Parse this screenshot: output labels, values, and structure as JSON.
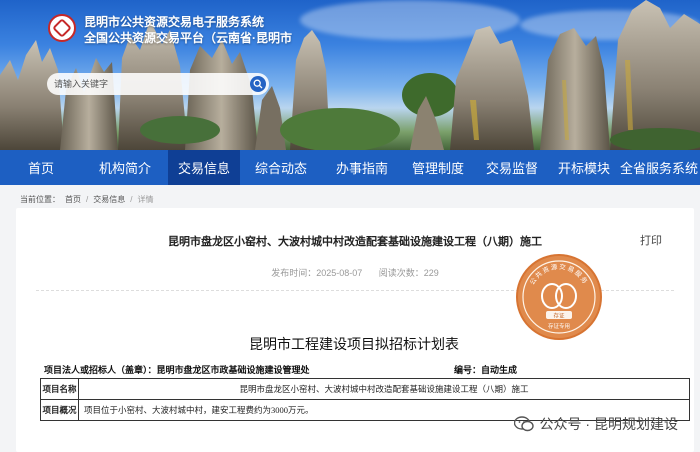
{
  "header": {
    "title_line1": "昆明市公共资源交易电子服务系统",
    "title_line2": "全国公共资源交易平台（云南省·昆明市",
    "search_placeholder": "请输入关键字"
  },
  "nav": {
    "items": [
      {
        "label": "首页",
        "active": false
      },
      {
        "label": "机构简介",
        "active": false
      },
      {
        "label": "交易信息",
        "active": true
      },
      {
        "label": "综合动态",
        "active": false
      },
      {
        "label": "办事指南",
        "active": false
      },
      {
        "label": "管理制度",
        "active": false
      },
      {
        "label": "交易监督",
        "active": false
      },
      {
        "label": "开标模块",
        "active": false
      },
      {
        "label": "全省服务系统",
        "active": false
      }
    ]
  },
  "breadcrumb": {
    "prefix": "当前位置：",
    "items": [
      "首页",
      "交易信息",
      "详情"
    ]
  },
  "article": {
    "title": "昆明市盘龙区小窑村、大波村城中村改造配套基础设施建设工程（八期）施工",
    "print_label": "打印",
    "publish_time": "发布时间：2025-08-07",
    "read_count": "阅读次数：229"
  },
  "document": {
    "title": "昆明市工程建设项目拟招标计划表",
    "tenderer_label": "项目法人或招标人（盖章）：昆明市盘龙区市政基础设施建设管理处",
    "number_label": "编号：自动生成",
    "rows": [
      {
        "label": "项目名称",
        "value": "昆明市盘龙区小窑村、大波村城中村改造配套基础设施建设工程（八期）施工"
      },
      {
        "label": "项目概况",
        "value": "项目位于小窑村、大波村城中村，建安工程费约为3000万元。"
      }
    ],
    "seal_text_top": "公共资源交易服务",
    "seal_text_bottom": "存证",
    "seal_badge": "存证专用"
  },
  "watermark": {
    "text": "公众号 · 昆明规划建设"
  },
  "colors": {
    "nav_bg": "#1d5fc2",
    "nav_active": "#0f3f95",
    "seal": "#e08a4c"
  }
}
